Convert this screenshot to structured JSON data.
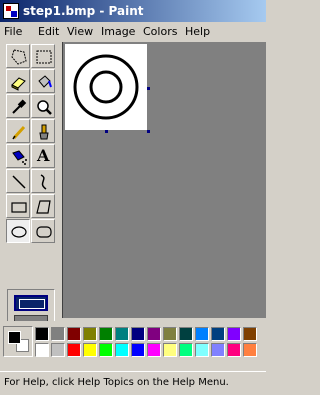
{
  "title": "step1.bmp - Paint",
  "menu": [
    "File",
    "Edit",
    "View",
    "Image",
    "Colors",
    "Help"
  ],
  "tools": [
    {
      "name": "free-form-select-icon"
    },
    {
      "name": "select-icon"
    },
    {
      "name": "eraser-icon"
    },
    {
      "name": "fill-with-color-icon"
    },
    {
      "name": "pick-color-icon"
    },
    {
      "name": "magnifier-icon"
    },
    {
      "name": "pencil-icon"
    },
    {
      "name": "brush-icon"
    },
    {
      "name": "airbrush-icon"
    },
    {
      "name": "text-icon",
      "glyph": "A"
    },
    {
      "name": "line-icon"
    },
    {
      "name": "curve-icon"
    },
    {
      "name": "rectangle-icon"
    },
    {
      "name": "polygon-icon"
    },
    {
      "name": "ellipse-icon",
      "active": true
    },
    {
      "name": "rounded-rectangle-icon"
    }
  ],
  "palette": {
    "foreground": "#000000",
    "background": "#ffffff",
    "top_row": [
      "#000000",
      "#808080",
      "#800000",
      "#808000",
      "#008000",
      "#008080",
      "#000080",
      "#800080",
      "#808040",
      "#004040",
      "#0080ff",
      "#004080",
      "#8000ff",
      "#804000"
    ],
    "bottom_row": [
      "#ffffff",
      "#c0c0c0",
      "#ff0000",
      "#ffff00",
      "#00ff00",
      "#00ffff",
      "#0000ff",
      "#ff00ff",
      "#ffff80",
      "#00ff80",
      "#80ffff",
      "#8080ff",
      "#ff0080",
      "#ff8040"
    ]
  },
  "status": "For Help, click Help Topics on the Help Menu."
}
